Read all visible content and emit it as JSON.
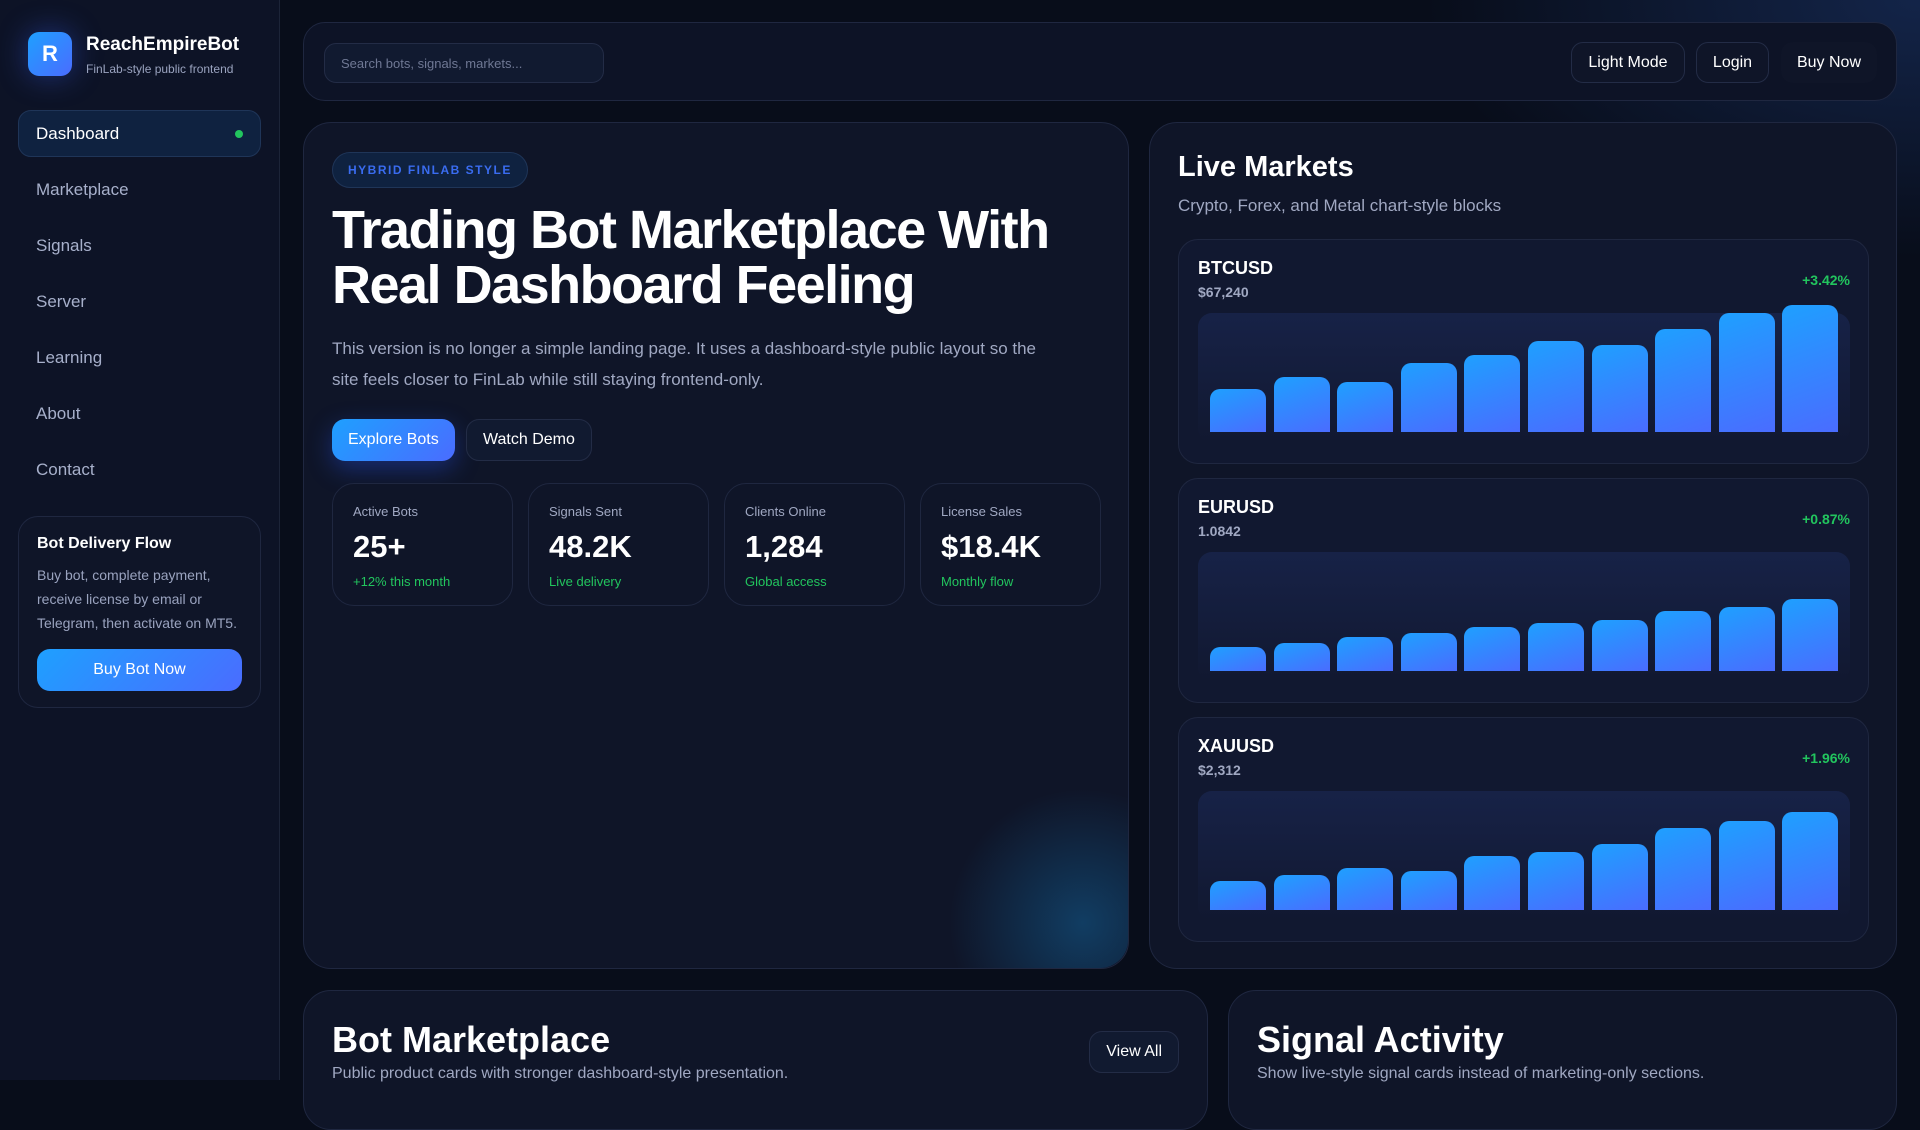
{
  "brand": {
    "logo_letter": "R",
    "title": "ReachEmpireBot",
    "subtitle": "FinLab-style public frontend"
  },
  "nav": [
    "Dashboard",
    "Marketplace",
    "Signals",
    "Server",
    "Learning",
    "About",
    "Contact"
  ],
  "delivery": {
    "title": "Bot Delivery Flow",
    "text": "Buy bot, complete payment, receive license by email or Telegram, then activate on MT5.",
    "button": "Buy Bot Now"
  },
  "topbar": {
    "search_placeholder": "Search bots, signals, markets...",
    "light_mode": "Light Mode",
    "login": "Login",
    "buy_now": "Buy Now"
  },
  "hero": {
    "badge": "HYBRID FINLAB STYLE",
    "title": "Trading Bot Marketplace With Real Dashboard Feeling",
    "text": "This version is no longer a simple landing page. It uses a dashboard-style public layout so the site feels closer to FinLab while still staying frontend-only.",
    "explore": "Explore Bots",
    "watch": "Watch Demo",
    "stats": [
      {
        "label": "Active Bots",
        "value": "25+",
        "note": "+12% this month"
      },
      {
        "label": "Signals Sent",
        "value": "48.2K",
        "note": "Live delivery"
      },
      {
        "label": "Clients Online",
        "value": "1,284",
        "note": "Global access"
      },
      {
        "label": "License Sales",
        "value": "$18.4K",
        "note": "Monthly flow"
      }
    ]
  },
  "live": {
    "title": "Live Markets",
    "subtitle": "Crypto, Forex, and Metal chart-style blocks",
    "markets": [
      {
        "symbol": "BTCUSD",
        "price": "$67,240",
        "change": "+3.42%",
        "bars": [
          35,
          45,
          41,
          56,
          63,
          74,
          71,
          84,
          97,
          104
        ]
      },
      {
        "symbol": "EURUSD",
        "price": "1.0842",
        "change": "+0.87%",
        "bars": [
          20,
          23,
          28,
          31,
          36,
          39,
          42,
          49,
          52,
          59
        ]
      },
      {
        "symbol": "XAUUSD",
        "price": "$2,312",
        "change": "+1.96%",
        "bars": [
          24,
          29,
          34,
          32,
          44,
          47,
          54,
          67,
          73,
          80
        ]
      }
    ]
  },
  "marketplace": {
    "title": "Bot Marketplace",
    "subtitle": "Public product cards with stronger dashboard-style presentation.",
    "view_all": "View All"
  },
  "signals": {
    "title": "Signal Activity",
    "subtitle": "Show live-style signal cards instead of marketing-only sections."
  }
}
